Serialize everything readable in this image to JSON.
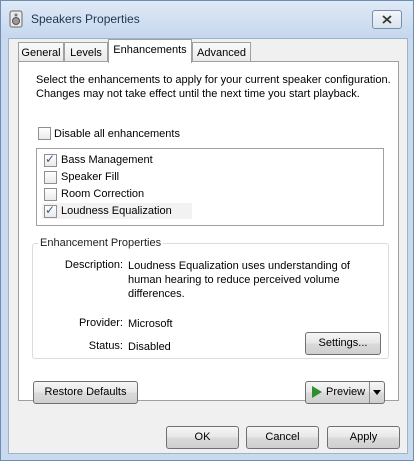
{
  "window": {
    "title": "Speakers Properties"
  },
  "tabs": [
    {
      "label": "General"
    },
    {
      "label": "Levels"
    },
    {
      "label": "Enhancements",
      "active": true
    },
    {
      "label": "Advanced"
    }
  ],
  "enhancements": {
    "description": "Select the enhancements to apply for your current speaker configuration. Changes may not take effect until the next time you start playback.",
    "disable_all": {
      "label": "Disable all enhancements",
      "checked": false
    },
    "items": [
      {
        "label": "Bass Management",
        "checked": true
      },
      {
        "label": "Speaker Fill",
        "checked": false
      },
      {
        "label": "Room Correction",
        "checked": false
      },
      {
        "label": "Loudness Equalization",
        "checked": true,
        "selected": true
      }
    ]
  },
  "properties": {
    "title": "Enhancement Properties",
    "description_label": "Description:",
    "description_value": "Loudness Equalization uses understanding of human hearing to reduce perceived volume differences.",
    "provider_label": "Provider:",
    "provider_value": "Microsoft",
    "status_label": "Status:",
    "status_value": "Disabled",
    "settings_button": "Settings..."
  },
  "buttons": {
    "restore_defaults": "Restore Defaults",
    "preview": "Preview",
    "ok": "OK",
    "cancel": "Cancel",
    "apply": "Apply"
  },
  "check_glyph": "✓"
}
